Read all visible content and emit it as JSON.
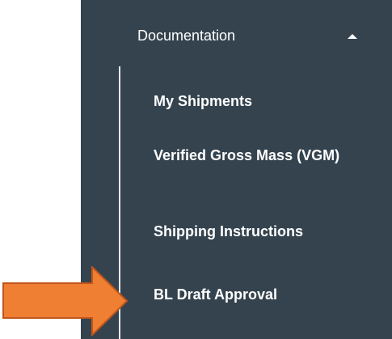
{
  "sidebar": {
    "section": {
      "title": "Documentation",
      "state_icon": "chevron-up-icon"
    },
    "items": [
      {
        "label": "My Shipments"
      },
      {
        "label": "Verified Gross Mass (VGM)"
      },
      {
        "label": "Shipping Instructions"
      },
      {
        "label": "BL Draft Approval"
      }
    ]
  },
  "annotation": {
    "type": "pointer-arrow",
    "target": "BL Draft Approval",
    "color": "#ee7f33",
    "border_color": "#c2551a"
  },
  "colors": {
    "sidebar_background": "#34434e",
    "text": "#ffffff"
  }
}
